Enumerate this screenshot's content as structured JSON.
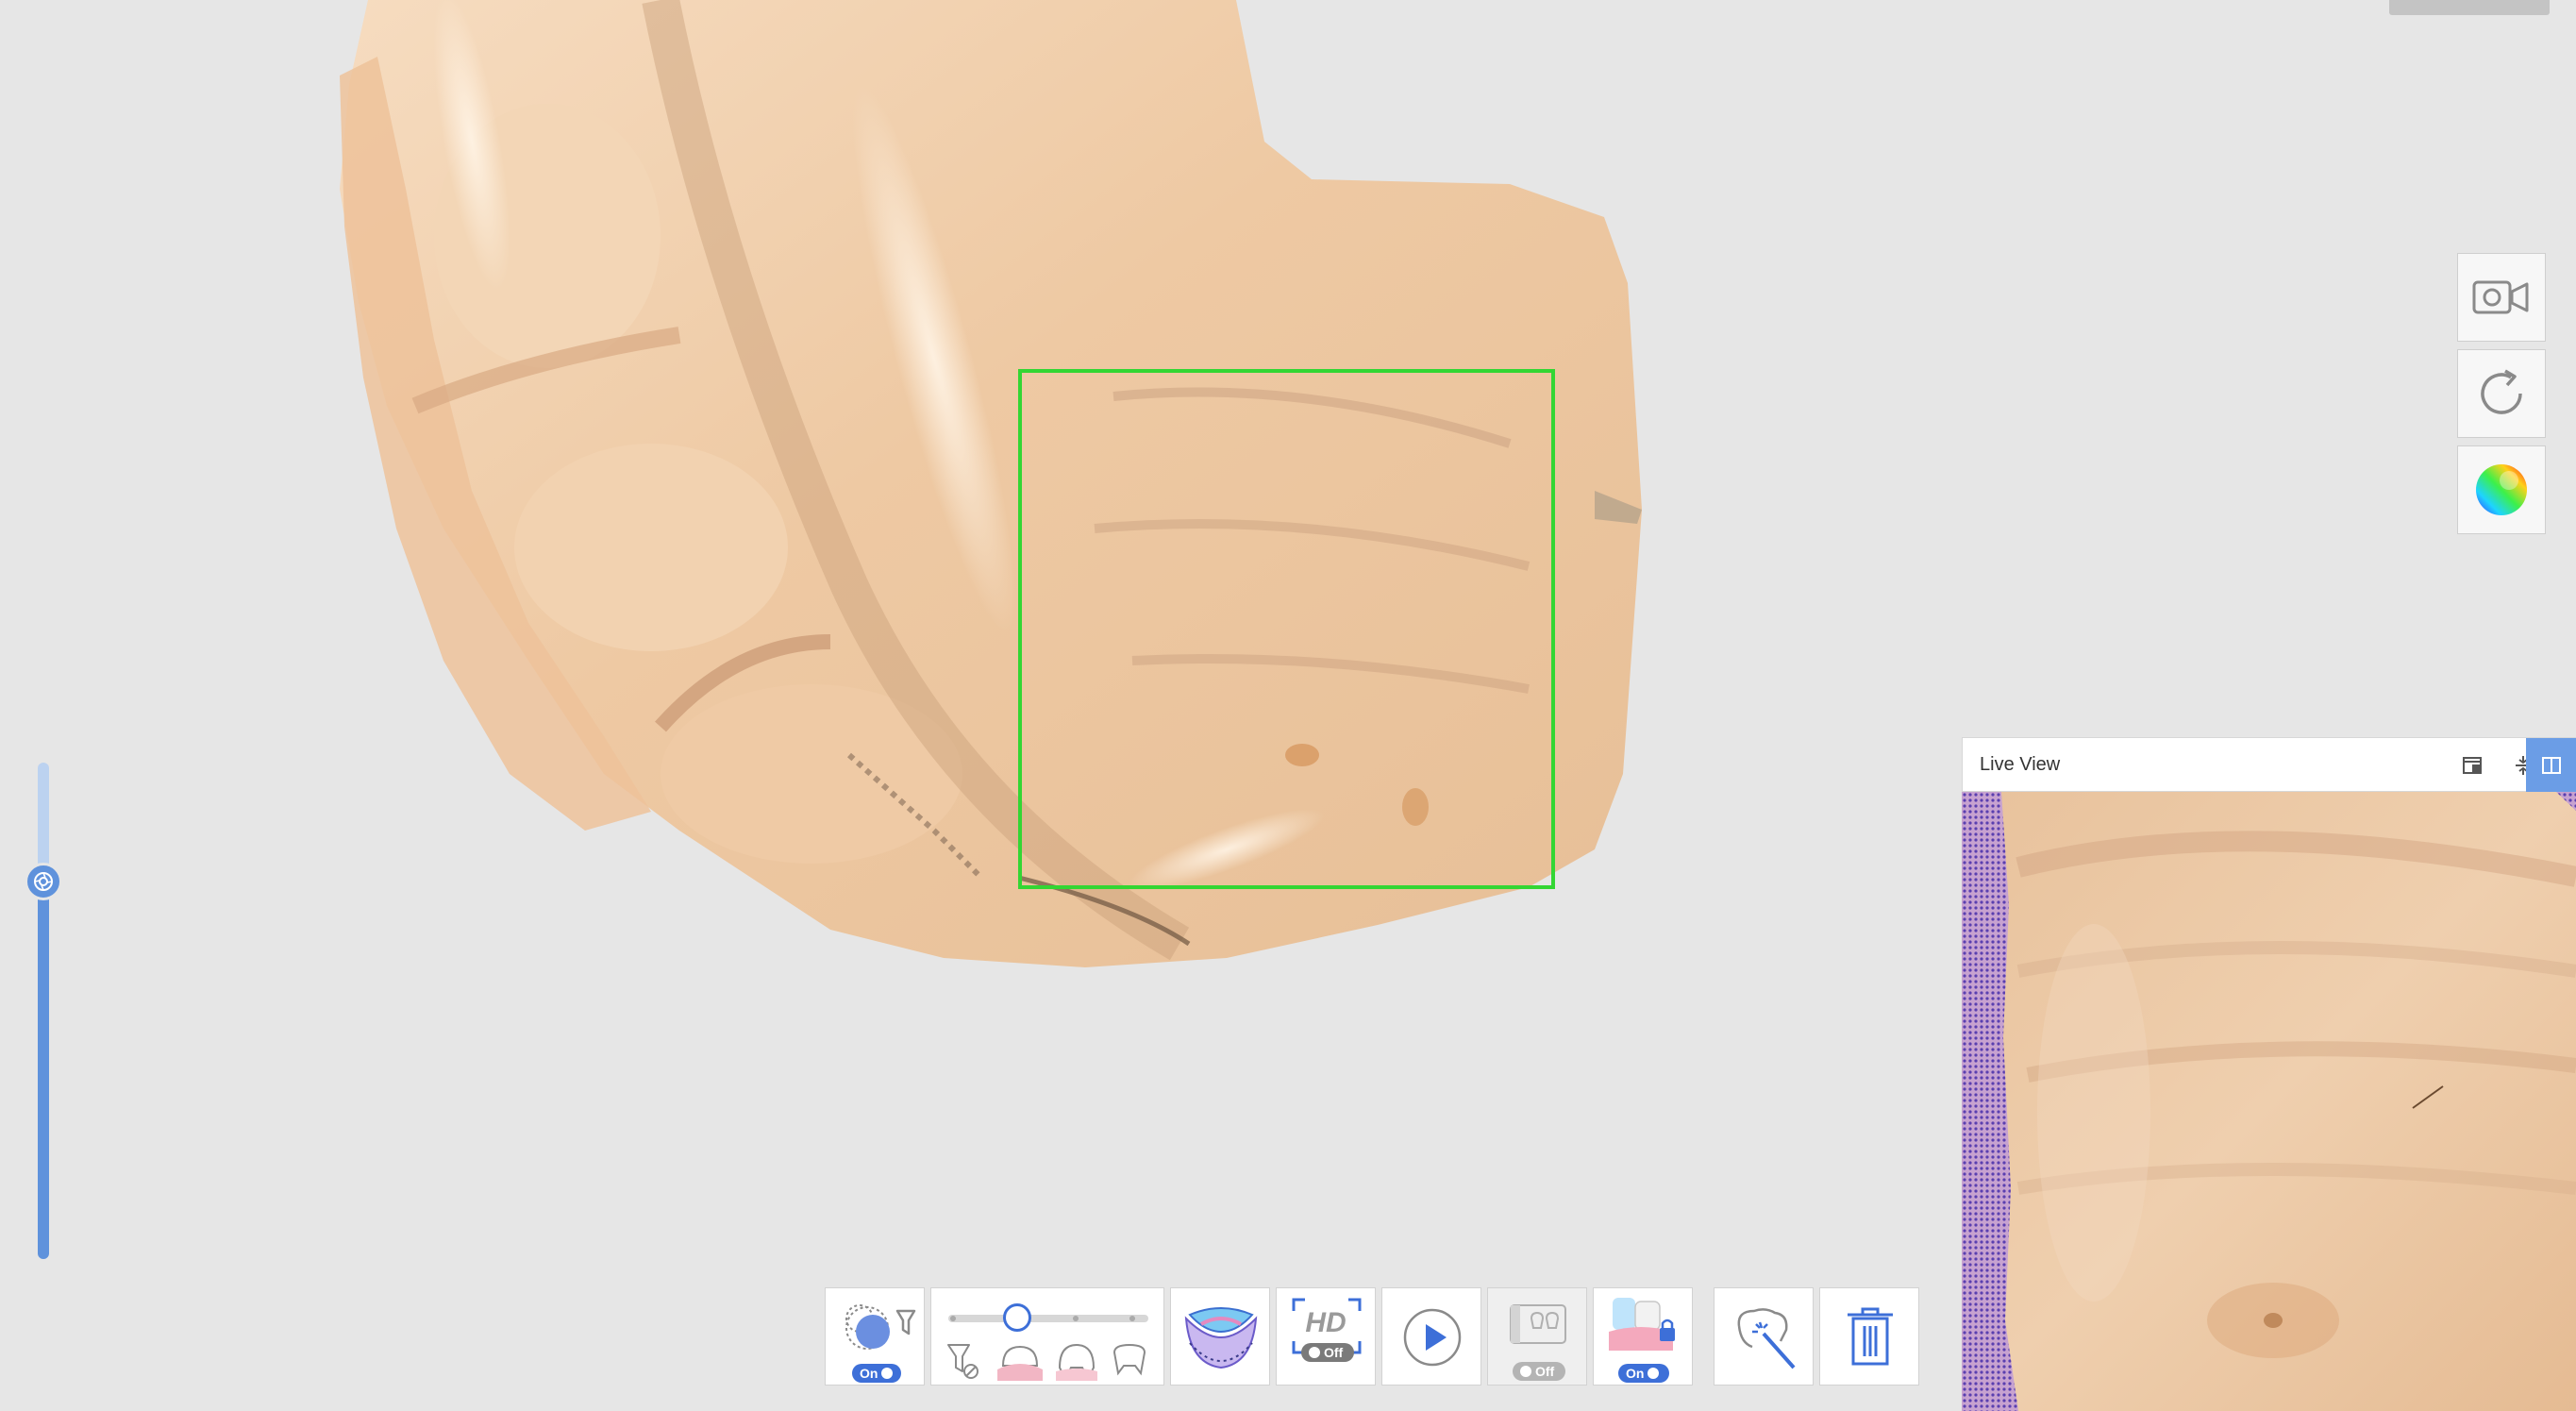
{
  "canvas": {
    "scan_frame_color": "#33d633",
    "background": "#e6e6e6"
  },
  "side_tools": [
    {
      "name": "video-camera-icon"
    },
    {
      "name": "rotate-reset-icon"
    },
    {
      "name": "color-map-sphere-icon"
    }
  ],
  "zoom_slider": {
    "level": 0.76,
    "icon": "aperture-icon"
  },
  "live_view": {
    "title": "Live View",
    "buttons": [
      {
        "name": "pin-window-icon"
      },
      {
        "name": "fit-vertical-icon"
      },
      {
        "name": "split-view-icon",
        "active": true
      }
    ]
  },
  "toolbar": {
    "ai_filter": {
      "state": "On",
      "icon": "ai-filter-icon"
    },
    "scan_mode_slider": {
      "position": 0.35,
      "icons": [
        "filter-off-icon",
        "gum-tooth-icon",
        "tooth-gum-icon",
        "tooth-icon"
      ]
    },
    "arch_button": {
      "icon": "dental-arch-icon"
    },
    "hd_mode": {
      "label": "HD",
      "state": "Off"
    },
    "play_button": {
      "icon": "play-icon"
    },
    "occlusion_mode": {
      "state": "Off",
      "icon": "occlusion-icon"
    },
    "lock_region": {
      "state": "On",
      "icon": "lock-teeth-icon"
    },
    "smart_select": {
      "icon": "magic-select-icon"
    },
    "delete": {
      "icon": "trash-icon"
    }
  },
  "accent_color": "#3d6fd8"
}
